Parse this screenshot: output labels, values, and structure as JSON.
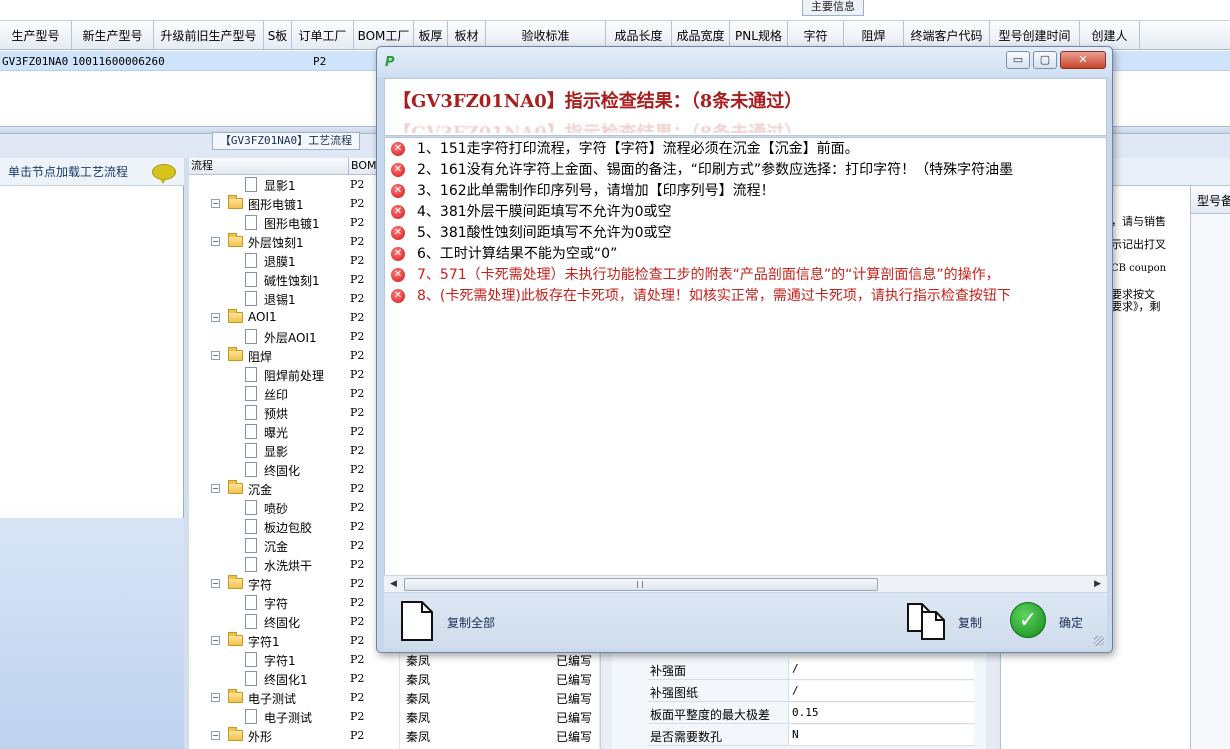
{
  "window": {
    "group_label": "主要信息"
  },
  "grid": {
    "columns": [
      "生产型号",
      "新生产型号",
      "升级前旧生产型号",
      "S板",
      "订单工厂",
      "BOM工厂",
      "板厚",
      "板材",
      "验收标准",
      "成品长度",
      "成品宽度",
      "PNL规格",
      "字符",
      "阻焊",
      "终端客户代码",
      "型号创建时间",
      "创建人"
    ],
    "row": {
      "model": "GV3FZ01NA0",
      "new_model": "10011600006260",
      "s_board": "P2"
    }
  },
  "flow_tab": {
    "label": "【GV3FZ01NA0】工艺流程"
  },
  "left_panel": {
    "title": "单击节点加载工艺流程",
    "icon": "speech-bubble-icon"
  },
  "tree": {
    "headers": [
      "流程",
      "BOM"
    ],
    "rows": [
      {
        "label": "显影1",
        "bom": "P2",
        "type": "doc",
        "level": 2
      },
      {
        "label": "图形电镀1",
        "bom": "P2",
        "type": "folder",
        "level": 1
      },
      {
        "label": "图形电镀1",
        "bom": "P2",
        "type": "doc",
        "level": 2
      },
      {
        "label": "外层蚀刻1",
        "bom": "P2",
        "type": "folder",
        "level": 1
      },
      {
        "label": "退膜1",
        "bom": "P2",
        "type": "doc",
        "level": 2
      },
      {
        "label": "碱性蚀刻1",
        "bom": "P2",
        "type": "doc",
        "level": 2
      },
      {
        "label": "退锡1",
        "bom": "P2",
        "type": "doc",
        "level": 2
      },
      {
        "label": "AOI1",
        "bom": "P2",
        "type": "folder",
        "level": 1
      },
      {
        "label": "外层AOI1",
        "bom": "P2",
        "type": "doc",
        "level": 2
      },
      {
        "label": "阻焊",
        "bom": "P2",
        "type": "folder",
        "level": 1
      },
      {
        "label": "阻焊前处理",
        "bom": "P2",
        "type": "doc",
        "level": 2
      },
      {
        "label": "丝印",
        "bom": "P2",
        "type": "doc",
        "level": 2
      },
      {
        "label": "预烘",
        "bom": "P2",
        "type": "doc",
        "level": 2
      },
      {
        "label": "曝光",
        "bom": "P2",
        "type": "doc",
        "level": 2
      },
      {
        "label": "显影",
        "bom": "P2",
        "type": "doc",
        "level": 2
      },
      {
        "label": "终固化",
        "bom": "P2",
        "type": "doc",
        "level": 2
      },
      {
        "label": "沉金",
        "bom": "P2",
        "type": "folder",
        "level": 1
      },
      {
        "label": "喷砂",
        "bom": "P2",
        "type": "doc",
        "level": 2
      },
      {
        "label": "板边包胶",
        "bom": "P2",
        "type": "doc",
        "level": 2
      },
      {
        "label": "沉金",
        "bom": "P2",
        "type": "doc",
        "level": 2
      },
      {
        "label": "水洗烘干",
        "bom": "P2",
        "type": "doc",
        "level": 2
      },
      {
        "label": "字符",
        "bom": "P2",
        "type": "folder",
        "level": 1
      },
      {
        "label": "字符",
        "bom": "P2",
        "type": "doc",
        "level": 2
      },
      {
        "label": "终固化",
        "bom": "P2",
        "type": "doc",
        "level": 2
      },
      {
        "label": "字符1",
        "bom": "P2",
        "type": "folder",
        "level": 1
      },
      {
        "label": "字符1",
        "bom": "P2",
        "type": "doc",
        "level": 2
      },
      {
        "label": "终固化1",
        "bom": "P2",
        "type": "doc",
        "level": 2
      },
      {
        "label": "电子测试",
        "bom": "P2",
        "type": "folder",
        "level": 1
      },
      {
        "label": "电子测试",
        "bom": "P2",
        "type": "doc",
        "level": 2
      },
      {
        "label": "外形",
        "bom": "P2",
        "type": "folder",
        "level": 1
      }
    ]
  },
  "mid_column": {
    "rows": [
      {
        "factory": "秦凤",
        "status": "已编写"
      },
      {
        "factory": "秦凤",
        "status": "已编写"
      },
      {
        "factory": "秦凤",
        "status": "已编写"
      },
      {
        "factory": "秦凤",
        "status": "已编写"
      },
      {
        "factory": "秦凤",
        "status": "已编写"
      },
      {
        "factory": "秦凤",
        "status": "已编写"
      }
    ]
  },
  "properties": [
    {
      "key": "补强面",
      "value": "/"
    },
    {
      "key": "补强图纸",
      "value": "/"
    },
    {
      "key": "板面平整度的最大极差",
      "value": "0.15"
    },
    {
      "key": "是否需要数孔",
      "value": "N"
    }
  ],
  "right_panel": {
    "column_header": "型号备",
    "texts": [
      "，请与销售",
      "示记出打叉",
      "CB coupon",
      "要求按文",
      "要求》，剩"
    ]
  },
  "dialog": {
    "heading": "【GV3FZ01NA0】指示检查结果：（8条未通过）",
    "heading_ghost": "【GV3FZ01NA0】指示检查结果：（8条未通过）",
    "items": [
      {
        "text": "1、151走字符打印流程，字符【字符】流程必须在沉金【沉金】前面。",
        "red": false
      },
      {
        "text": "2、161没有允许字符上金面、锡面的备注，“印刷方式”参数应选择：打印字符！（特殊字符油墨",
        "red": false
      },
      {
        "text": "3、162此单需制作印序列号，请增加【印序列号】流程！",
        "red": false
      },
      {
        "text": "4、381外层干膜间距填写不允许为0或空",
        "red": false
      },
      {
        "text": "5、381酸性蚀刻间距填写不允许为0或空",
        "red": false
      },
      {
        "text": "6、工时计算结果不能为空或“0”",
        "red": false
      },
      {
        "text": "7、571（卡死需处理）未执行功能检查工步的附表“产品剖面信息”的“计算剖面信息”的操作，",
        "red": true
      },
      {
        "text": "8、(卡死需处理)此板存在卡死项，请处理！如核实正常，需通过卡死项，请执行指示检查按钮下",
        "red": true
      }
    ],
    "buttons": {
      "copy_all": "复制全部",
      "copy": "复制",
      "ok": "确定"
    },
    "window_buttons": {
      "minimize": "▭",
      "maximize": "▢",
      "close": "✕"
    },
    "colors": {
      "heading": "#a91e1e",
      "error_item": "#c8201a",
      "ok": "#1c9a2a"
    }
  }
}
